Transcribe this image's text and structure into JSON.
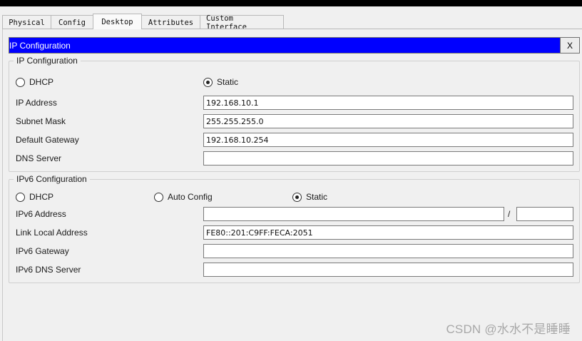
{
  "tabs": [
    "Physical",
    "Config",
    "Desktop",
    "Attributes",
    "Custom Interface"
  ],
  "active_tab": "Desktop",
  "window": {
    "title": "IP Configuration",
    "close_label": "X"
  },
  "ipv4": {
    "legend": "IP Configuration",
    "mode_options": {
      "dhcp": "DHCP",
      "static": "Static"
    },
    "selected_mode": "Static",
    "ip_address": {
      "label": "IP Address",
      "value": "192.168.10.1"
    },
    "subnet_mask": {
      "label": "Subnet Mask",
      "value": "255.255.255.0"
    },
    "default_gateway": {
      "label": "Default Gateway",
      "value": "192.168.10.254"
    },
    "dns_server": {
      "label": "DNS Server",
      "value": ""
    }
  },
  "ipv6": {
    "legend": "IPv6 Configuration",
    "mode_options": {
      "dhcp": "DHCP",
      "auto": "Auto Config",
      "static": "Static"
    },
    "selected_mode": "Static",
    "ipv6_address": {
      "label": "IPv6 Address",
      "value": "",
      "prefix": "",
      "separator": "/"
    },
    "link_local": {
      "label": "Link Local Address",
      "value": "FE80::201:C9FF:FECA:2051"
    },
    "gateway": {
      "label": "IPv6 Gateway",
      "value": ""
    },
    "dns_server": {
      "label": "IPv6 DNS Server",
      "value": ""
    }
  },
  "watermark": "CSDN @水水不是睡睡",
  "colors": {
    "titlebar": "#0000ff",
    "background": "#f0f0f0"
  }
}
